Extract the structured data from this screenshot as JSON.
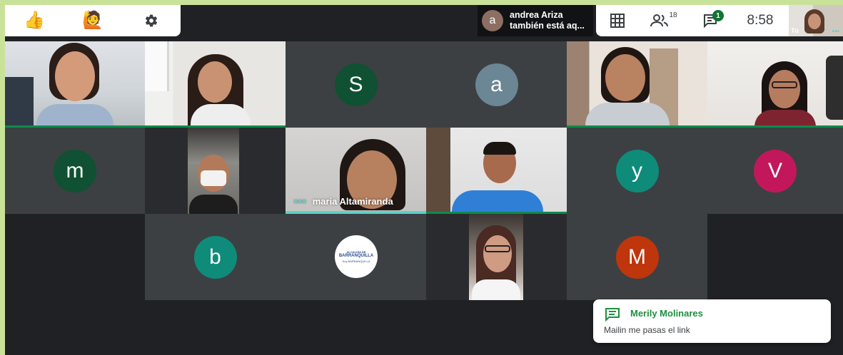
{
  "toolbar_left": {
    "items": [
      {
        "name": "thumbs-up-icon",
        "glyph": "👍"
      },
      {
        "name": "raise-hand-icon",
        "glyph": "🙋"
      },
      {
        "name": "settings-icon"
      }
    ]
  },
  "join_notice": {
    "avatar_letter": "a",
    "name": "andrea Ariza",
    "text": "también está aq..."
  },
  "toolbar_right": {
    "participants_count": "18",
    "chat_unread": "1",
    "time": "8:58",
    "self_label": "Tú"
  },
  "tiles": [
    {
      "id": "s",
      "letter": "S",
      "color": "#0f5132"
    },
    {
      "id": "a",
      "letter": "a",
      "color": "#6b8694"
    },
    {
      "id": "m-lower",
      "letter": "m",
      "color": "#0f5132"
    },
    {
      "id": "y",
      "letter": "y",
      "color": "#0f8b7a"
    },
    {
      "id": "v",
      "letter": "V",
      "color": "#c2185b"
    },
    {
      "id": "b",
      "letter": "b",
      "color": "#0f8b7a"
    },
    {
      "id": "m-upper",
      "letter": "M",
      "color": "#bf360c"
    }
  ],
  "active_speaker": {
    "name": "maria Altamiranda"
  },
  "logo": {
    "line1": "ALCALDÍA DE",
    "line2": "BARRANQUILLA",
    "line3": "Soy BARRANQUILLA"
  },
  "chat_toast": {
    "sender": "Merily Molinares",
    "message": "Mailin me pasas el link"
  },
  "colors": {
    "accent": "#1e8e3e",
    "speaking": "#0e8a4b",
    "teal": "#5bd2c7",
    "badge": "#137333"
  }
}
